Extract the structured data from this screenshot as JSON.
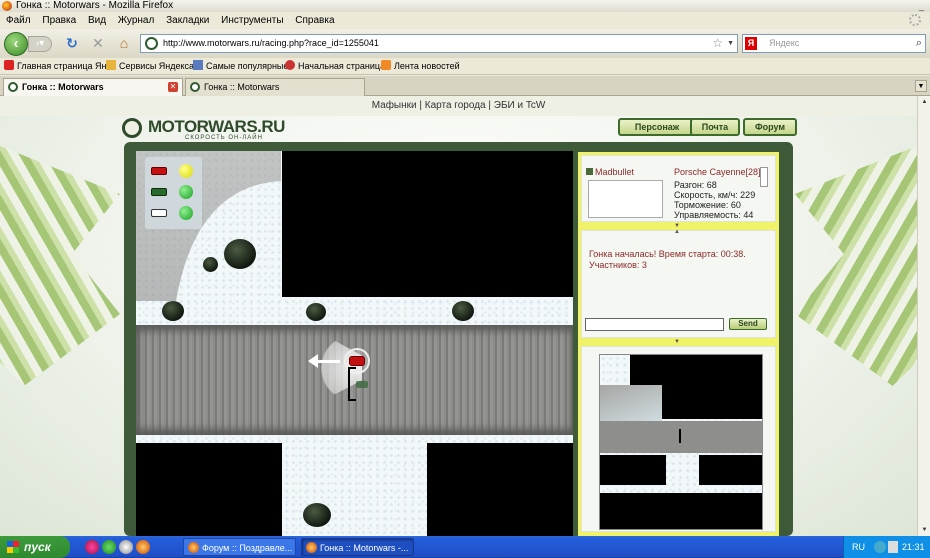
{
  "window": {
    "title": "Гонка :: Motorwars - Mozilla Firefox"
  },
  "menu": [
    "Файл",
    "Правка",
    "Вид",
    "Журнал",
    "Закладки",
    "Инструменты",
    "Справка"
  ],
  "nav": {
    "url": "http://www.motorwars.ru/racing.php?race_id=1255041",
    "search_placeholder": "Яндекс",
    "search_engine_badge": "Я"
  },
  "bookmarks": [
    {
      "label": "Главная страница Ян...",
      "icon": "page-icon",
      "color": "#d22"
    },
    {
      "label": "Сервисы Яндекса",
      "icon": "folder-icon",
      "color": "#e6b43c"
    },
    {
      "label": "Самые популярные",
      "icon": "popular-icon",
      "color": "#5a7abf"
    },
    {
      "label": "Начальная страница",
      "icon": "firefox-icon",
      "color": "#c33"
    },
    {
      "label": "Лента новостей",
      "icon": "rss-icon",
      "color": "#f08a24"
    }
  ],
  "tabs": [
    {
      "label": "Гонка :: Motorwars",
      "active": true
    },
    {
      "label": "Гонка :: Motorwars",
      "active": false
    }
  ],
  "site_nav": {
    "link1": "Мафынки",
    "sep": "|",
    "link2": "Карта города",
    "link3": "ЭБИ и TcW"
  },
  "site": {
    "logo": "MOTORWARS.RU",
    "logo_sub": "СКОРОСТЬ ОН-ЛАЙН",
    "buttons": [
      "Персонаж",
      "Почта",
      "Форум"
    ]
  },
  "player": {
    "name": "Madbullet",
    "car": "Porsche Cayenne",
    "car_level": "[28]",
    "stats": [
      "Разгон: 68",
      "Скорость, км/ч: 229",
      "Торможение: 60",
      "Управляемость: 44"
    ]
  },
  "race_message": {
    "line1": "Гонка началась! Время старта: 00:38.",
    "line2": "Участников: 3"
  },
  "chat": {
    "input_value": "",
    "send_label": "Send"
  },
  "race_lights": [
    {
      "car_color": "#c41010",
      "lamp_color": "#f0f010"
    },
    {
      "car_color": "#2a6a2a",
      "lamp_color": "#3cc040"
    },
    {
      "car_color": "#ffffff",
      "lamp_color": "#3cc040"
    }
  ],
  "taskbar": {
    "start_label": "пуск",
    "tasks": [
      "Форум :: Поздравле...",
      "Гонка :: Motorwars -..."
    ],
    "lang": "RU",
    "clock": "21:31"
  }
}
